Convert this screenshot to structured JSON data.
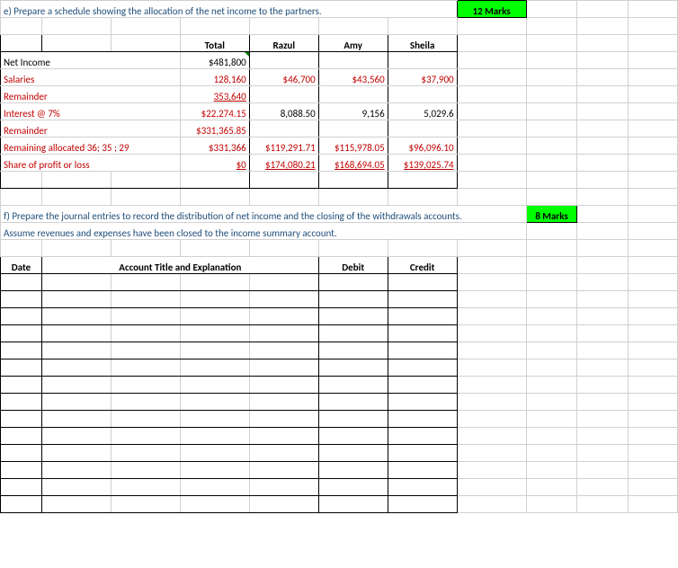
{
  "q_e": {
    "text": "e) Prepare a schedule showing the allocation of the net income to the partners.",
    "marks": "12 Marks"
  },
  "schedule": {
    "headers": {
      "total": "Total",
      "p1": "Razul",
      "p2": "Amy",
      "p3": "Sheila"
    },
    "rows": {
      "net_income": {
        "label": "Net Income",
        "total": "$481,800"
      },
      "salaries": {
        "label": "Salaries",
        "total": "128,160",
        "p1": "$46,700",
        "p2": "$43,560",
        "p3": "$37,900"
      },
      "remainder1": {
        "label": "Remainder",
        "total": "353,640"
      },
      "interest": {
        "label": "Interest @ 7%",
        "total": "$22,274.15",
        "p1": "8,088.50",
        "p2": "9,156",
        "p3": "5,029.6"
      },
      "remainder2": {
        "label": "Remainder",
        "total": "$331,365.85"
      },
      "remaining_alloc": {
        "label": "Remaining allocated 36; 35 ; 29",
        "total": "$331,366",
        "p1": "$119,291.71",
        "p2": "$115,978.05",
        "p3": "$96,096.10"
      },
      "share": {
        "label": "Share of profit or loss",
        "total": "$0",
        "p1": "$174,080.21",
        "p2": "$168,694.05",
        "p3": "$139,025.74"
      }
    }
  },
  "q_f": {
    "line1": "f) Prepare the journal entries to record the distribution of net income and the closing of the withdrawals accounts.",
    "line2": "Assume revenues and expenses have been closed to the income summary account.",
    "marks": "8 Marks"
  },
  "journal": {
    "headers": {
      "date": "Date",
      "account": "Account Title and Explanation",
      "debit": "Debit",
      "credit": "Credit"
    }
  },
  "chart_data": {
    "type": "table",
    "title": "Allocation of Net Income to Partners",
    "columns": [
      "",
      "Total",
      "Razul",
      "Amy",
      "Sheila"
    ],
    "rows": [
      [
        "Net Income",
        481800,
        null,
        null,
        null
      ],
      [
        "Salaries",
        128160,
        46700,
        43560,
        37900
      ],
      [
        "Remainder",
        353640,
        null,
        null,
        null
      ],
      [
        "Interest @ 7%",
        22274.15,
        8088.5,
        9156,
        5029.6
      ],
      [
        "Remainder",
        331365.85,
        null,
        null,
        null
      ],
      [
        "Remaining allocated 36;35;29",
        331366,
        119291.71,
        115978.05,
        96096.1
      ],
      [
        "Share of profit or loss",
        0,
        174080.21,
        168694.05,
        139025.74
      ]
    ]
  }
}
